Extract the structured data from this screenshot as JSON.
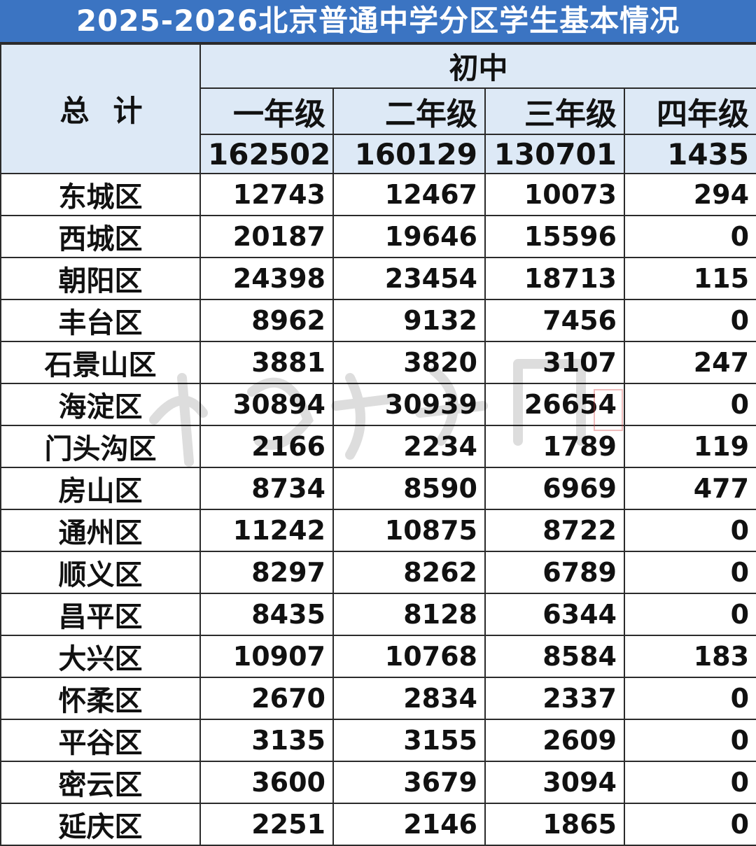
{
  "title": "2025-2026北京普通中学分区学生基本情况",
  "header": {
    "total_label": "总计",
    "group_label": "初中",
    "grades": [
      "一年级",
      "二年级",
      "三年级",
      "四年级"
    ],
    "totals": [
      "162502",
      "160129",
      "130701",
      "1435"
    ]
  },
  "rows": [
    {
      "district": "东城区",
      "values": [
        "12743",
        "12467",
        "10073",
        "294"
      ]
    },
    {
      "district": "西城区",
      "values": [
        "20187",
        "19646",
        "15596",
        "0"
      ]
    },
    {
      "district": "朝阳区",
      "values": [
        "24398",
        "23454",
        "18713",
        "115"
      ]
    },
    {
      "district": "丰台区",
      "values": [
        "8962",
        "9132",
        "7456",
        "0"
      ]
    },
    {
      "district": "石景山区",
      "values": [
        "3881",
        "3820",
        "3107",
        "247"
      ]
    },
    {
      "district": "海淀区",
      "values": [
        "30894",
        "30939",
        "26654",
        "0"
      ]
    },
    {
      "district": "门头沟区",
      "values": [
        "2166",
        "2234",
        "1789",
        "119"
      ]
    },
    {
      "district": "房山区",
      "values": [
        "8734",
        "8590",
        "6969",
        "477"
      ]
    },
    {
      "district": "通州区",
      "values": [
        "11242",
        "10875",
        "8722",
        "0"
      ]
    },
    {
      "district": "顺义区",
      "values": [
        "8297",
        "8262",
        "6789",
        "0"
      ]
    },
    {
      "district": "昌平区",
      "values": [
        "8435",
        "8128",
        "6344",
        "0"
      ]
    },
    {
      "district": "大兴区",
      "values": [
        "10907",
        "10768",
        "8584",
        "183"
      ]
    },
    {
      "district": "怀柔区",
      "values": [
        "2670",
        "2834",
        "2337",
        "0"
      ]
    },
    {
      "district": "平谷区",
      "values": [
        "3135",
        "3155",
        "2609",
        "0"
      ]
    },
    {
      "district": "密云区",
      "values": [
        "3600",
        "3679",
        "3094",
        "0"
      ]
    },
    {
      "district": "延庆区",
      "values": [
        "2251",
        "2146",
        "1865",
        "0"
      ]
    }
  ],
  "colors": {
    "title_bg": "#3b74c2",
    "header_bg": "#dde9f6",
    "grid": "#2b2b2b"
  }
}
